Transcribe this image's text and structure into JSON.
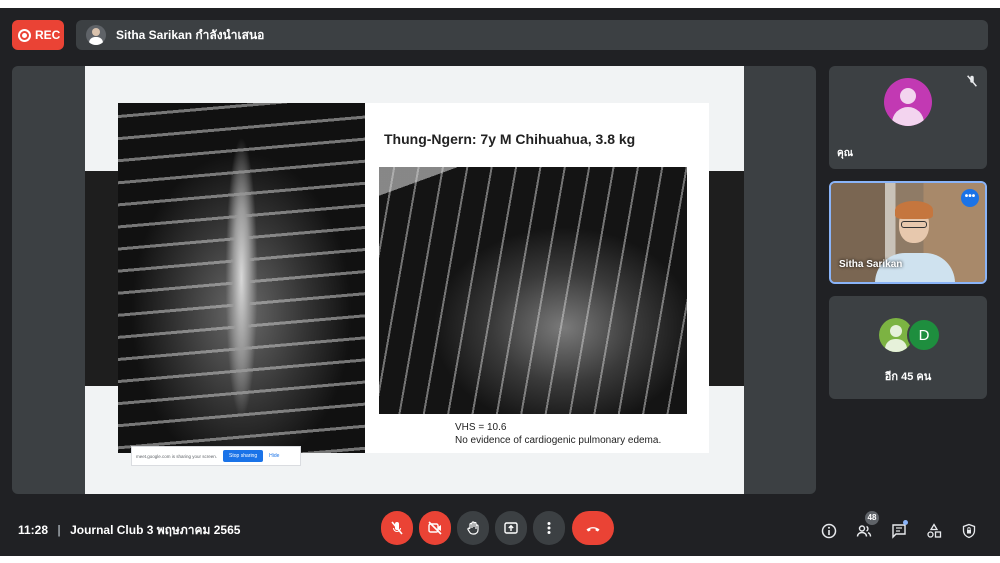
{
  "top_bar": {
    "rec_label": "REC",
    "presenter_text": "Sitha Sarikan กำลังนำเสนอ"
  },
  "slide": {
    "case_title": "Thung-Ngern: 7y M Chihuahua, 3.8 kg",
    "vhs_line": "VHS = 10.6",
    "finding_line": "No evidence of cardiogenic pulmonary edema.",
    "share_banner": {
      "text": "meet.google.com is sharing your screen.",
      "stop_label": "Stop sharing",
      "hide_label": "Hide"
    }
  },
  "participants": {
    "self_name": "คุณ",
    "presenter_name": "Sitha Sarikan",
    "more_avatar_letter": "D",
    "more_label": "อีก 45 คน"
  },
  "bottom_bar": {
    "time": "11:28",
    "meeting_title": "Journal Club 3 พฤษภาคม 2565",
    "people_count": "48"
  },
  "colors": {
    "background": "#202124",
    "tile": "#3c4043",
    "danger": "#ea4335",
    "accent": "#1a73e8",
    "highlight_border": "#8ab4f8"
  },
  "icons": [
    "record-icon",
    "mic-off-icon",
    "camera-off-icon",
    "raise-hand-icon",
    "present-icon",
    "more-options-icon",
    "end-call-icon",
    "info-icon",
    "people-icon",
    "chat-icon",
    "activities-icon",
    "host-controls-icon"
  ]
}
